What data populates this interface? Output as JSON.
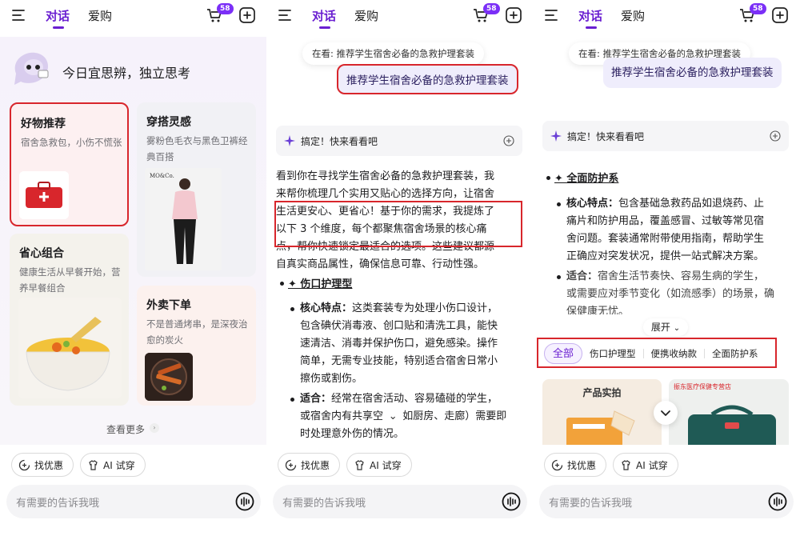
{
  "header": {
    "tab_chat": "对话",
    "tab_shop": "爱购",
    "cart_count": "58",
    "accent": "#6a1fd1"
  },
  "bottom": {
    "chip1": "找优惠",
    "chip2": "AI 试穿",
    "input_placeholder": "有需要的告诉我哦"
  },
  "screen1": {
    "greeting": "今日宜思辨，独立思考",
    "cards": [
      {
        "title": "好物推荐",
        "sub": "宿舍急救包，小伤不慌张"
      },
      {
        "title": "穿搭灵感",
        "sub": "雾粉色毛衣与黑色卫裤经典百搭",
        "img_text": "MO&Co."
      },
      {
        "title": "省心组合",
        "sub": "健康生活从早餐开始，营养早餐组合"
      },
      {
        "title": "外卖下单",
        "sub": "不是普通烤串，是深夜治愈的炭火"
      }
    ],
    "more": "查看更多"
  },
  "screen2": {
    "looking": "在看: 推荐学生宿舍必备的急救护理套装",
    "user_msg": "推荐学生宿舍必备的急救护理套装",
    "done": "搞定！快来看看吧",
    "para1_line1": "看到你在寻找学生宿舍必备的急救护理套装，我",
    "para1_line2": "来帮你梳理几个实用又贴心的选择方向，让宿舍",
    "para1_line3": "生活更安心、更省心！基于你的需求，我提炼了",
    "para1_line4": "以下 3 个维度，每个都聚焦宿舍场景的核心痛",
    "para1_line5": "点，帮你快速锁定最适合的选项。这些建议都源",
    "para1_line6": "自真实商品属性，确保信息可靠、行动性强。",
    "section_title": "✦ 伤口护理型",
    "feat_label": "核心特点：",
    "feat_l1": "这类套装专为处理小伤口设计，",
    "feat_l2": "包含碘伏消毒液、创口贴和清洗工具，能快",
    "feat_l3": "速清洁、消毒并保护伤口，避免感染。操作",
    "feat_l4": "简单，无需专业技能，特别适合宿舍日常小",
    "feat_l5": "擦伤或割伤。",
    "fit_label": "适合：",
    "fit_l1": "经常在宿舍活动、容易磕碰的学生，",
    "fit_l2": "或宿舍内有共享空",
    "fit_l2b": "如厨房、走廊）需要即",
    "fit_l3": "时处理意外伤的情况。"
  },
  "screen3": {
    "looking": "在看: 推荐学生宿舍必备的急救护理套装",
    "user_msg": "推荐学生宿舍必备的急救护理套装",
    "done": "搞定！快来看看吧",
    "section_title": "✦ 全面防护系",
    "feat_label": "核心特点：",
    "feat_l1": "包含基础急救药品如退烧药、止",
    "feat_l2": "痛片和防护用品，覆盖感冒、过敏等常见宿",
    "feat_l3": "舍问题。套装通常附带使用指南，帮助学生",
    "feat_l4": "正确应对突发状况，提供一站式解决方案。",
    "fit_label": "适合：",
    "fit_l1": "宿舍生活节奏快、容易生病的学生，",
    "fit_l2": "或需要应对季节变化（如流感季）的场景，确",
    "fit_l3": "保健康无忧。",
    "expand": "展开",
    "filters": [
      "全部",
      "伤口护理型",
      "便携收纳款",
      "全面防护系"
    ],
    "prod1_tag": "产品实拍",
    "prod2_tag": "振东医疗保健专营店"
  }
}
